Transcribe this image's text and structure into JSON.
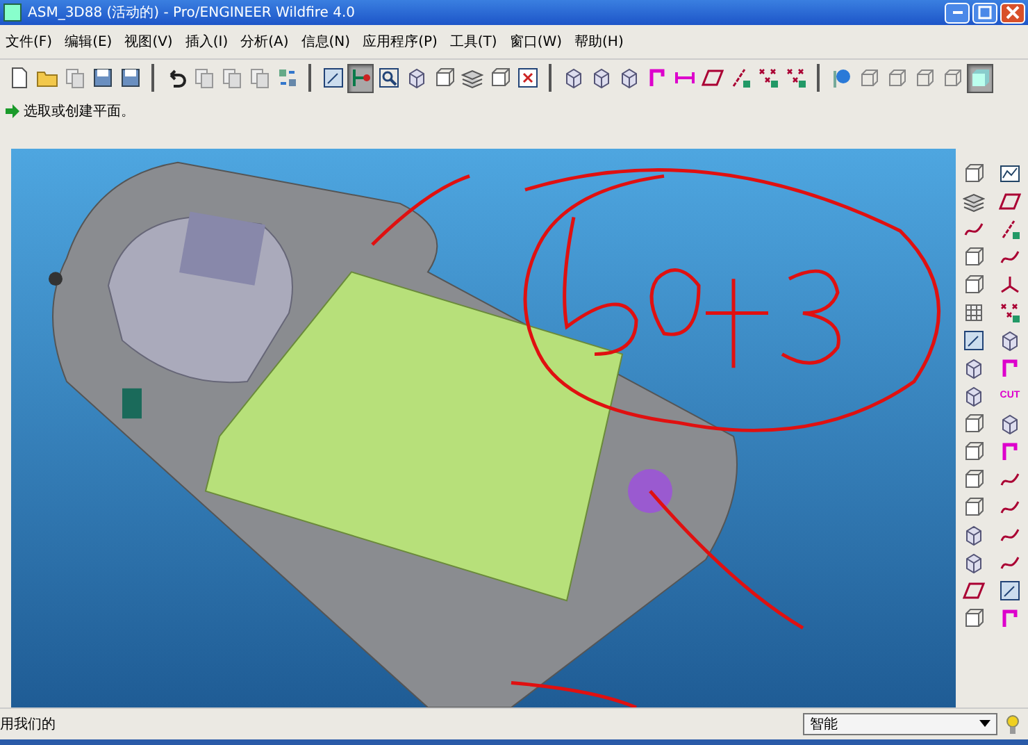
{
  "window": {
    "title": "ASM_3D88 (活动的) - Pro/ENGINEER Wildfire 4.0"
  },
  "menu": [
    {
      "label": "文件(F)"
    },
    {
      "label": "编辑(E)"
    },
    {
      "label": "视图(V)"
    },
    {
      "label": "插入(I)"
    },
    {
      "label": "分析(A)"
    },
    {
      "label": "信息(N)"
    },
    {
      "label": "应用程序(P)"
    },
    {
      "label": "工具(T)"
    },
    {
      "label": "窗口(W)"
    },
    {
      "label": "帮助(H)"
    }
  ],
  "toolbar": [
    {
      "kind": "doc",
      "pressed": false
    },
    {
      "kind": "folder",
      "pressed": false
    },
    {
      "kind": "copy",
      "pressed": false
    },
    {
      "kind": "save",
      "pressed": false
    },
    {
      "kind": "save",
      "pressed": false
    },
    {
      "kind": "separator"
    },
    {
      "kind": "undo",
      "pressed": false
    },
    {
      "kind": "copy",
      "pressed": false
    },
    {
      "kind": "copy",
      "pressed": false
    },
    {
      "kind": "copy",
      "pressed": false
    },
    {
      "kind": "regen",
      "pressed": false
    },
    {
      "kind": "separator"
    },
    {
      "kind": "view",
      "pressed": false
    },
    {
      "kind": "spin",
      "pressed": true
    },
    {
      "kind": "zoom",
      "pressed": false
    },
    {
      "kind": "feature",
      "pressed": false
    },
    {
      "kind": "box",
      "pressed": false
    },
    {
      "kind": "layers",
      "pressed": false
    },
    {
      "kind": "box",
      "pressed": false
    },
    {
      "kind": "close",
      "pressed": false
    },
    {
      "kind": "separator"
    },
    {
      "kind": "feature",
      "pressed": false
    },
    {
      "kind": "feature",
      "pressed": false
    },
    {
      "kind": "feature",
      "pressed": false
    },
    {
      "kind": "datum",
      "pressed": false
    },
    {
      "kind": "dim",
      "pressed": false
    },
    {
      "kind": "plane",
      "pressed": false
    },
    {
      "kind": "axis",
      "pressed": false
    },
    {
      "kind": "point",
      "pressed": false
    },
    {
      "kind": "point",
      "pressed": false
    },
    {
      "kind": "separator"
    },
    {
      "kind": "globe",
      "pressed": false
    },
    {
      "kind": "cube",
      "pressed": false
    },
    {
      "kind": "cube",
      "pressed": false
    },
    {
      "kind": "cube",
      "pressed": false
    },
    {
      "kind": "cube",
      "pressed": false
    },
    {
      "kind": "shade",
      "pressed": true
    }
  ],
  "message": {
    "text": "选取或创建平面。"
  },
  "right_toolbar": [
    {
      "kind": "box"
    },
    {
      "kind": "sketch"
    },
    {
      "kind": "layers"
    },
    {
      "kind": "plane"
    },
    {
      "kind": "curve"
    },
    {
      "kind": "axis"
    },
    {
      "kind": "box"
    },
    {
      "kind": "curve"
    },
    {
      "kind": "box"
    },
    {
      "kind": "csys"
    },
    {
      "kind": "grid"
    },
    {
      "kind": "point"
    },
    {
      "kind": "view"
    },
    {
      "kind": "feature"
    },
    {
      "kind": "feature"
    },
    {
      "kind": "datum"
    },
    {
      "kind": "feature"
    },
    {
      "kind": "text",
      "label": "CUT"
    },
    {
      "kind": "box"
    },
    {
      "kind": "feature"
    },
    {
      "kind": "box"
    },
    {
      "kind": "datum"
    },
    {
      "kind": "box"
    },
    {
      "kind": "curve"
    },
    {
      "kind": "box"
    },
    {
      "kind": "curve"
    },
    {
      "kind": "feature"
    },
    {
      "kind": "curve"
    },
    {
      "kind": "feature"
    },
    {
      "kind": "curve"
    },
    {
      "kind": "plane"
    },
    {
      "kind": "view"
    },
    {
      "kind": "box"
    },
    {
      "kind": "datum"
    }
  ],
  "status_bar": {
    "text": "用我们的",
    "filter": "智能"
  }
}
